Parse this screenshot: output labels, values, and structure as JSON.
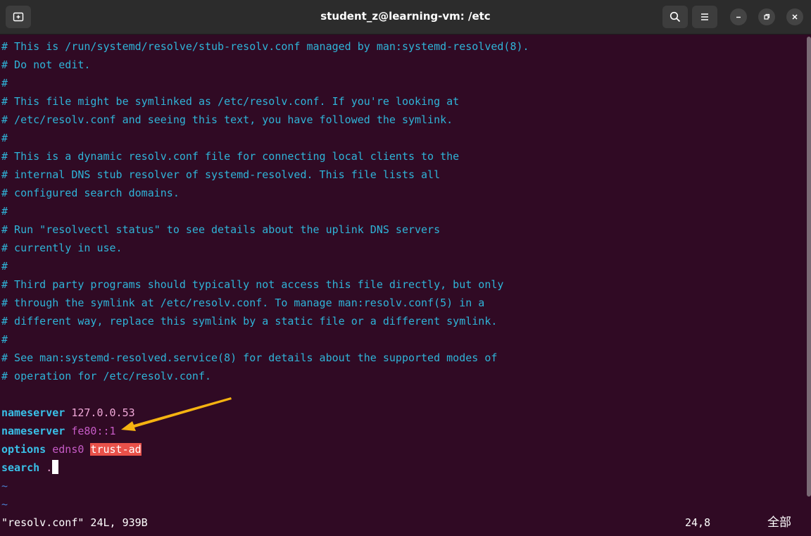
{
  "window": {
    "title": "student_z@learning-vm: /etc"
  },
  "icons": {
    "new_tab": "new-tab-icon",
    "search": "search-icon",
    "menu": "hamburger-menu-icon",
    "minimize": "minimize-icon",
    "maximize": "restore-icon",
    "close": "close-icon"
  },
  "editor": {
    "comment_lines": [
      "# This is /run/systemd/resolve/stub-resolv.conf managed by man:systemd-resolved(8).",
      "# Do not edit.",
      "#",
      "# This file might be symlinked as /etc/resolv.conf. If you're looking at",
      "# /etc/resolv.conf and seeing this text, you have followed the symlink.",
      "#",
      "# This is a dynamic resolv.conf file for connecting local clients to the",
      "# internal DNS stub resolver of systemd-resolved. This file lists all",
      "# configured search domains.",
      "#",
      "# Run \"resolvectl status\" to see details about the uplink DNS servers",
      "# currently in use.",
      "#",
      "# Third party programs should typically not access this file directly, but only",
      "# through the symlink at /etc/resolv.conf. To manage man:resolv.conf(5) in a",
      "# different way, replace this symlink by a static file or a different symlink.",
      "#",
      "# See man:systemd-resolved.service(8) for details about the supported modes of",
      "# operation for /etc/resolv.conf."
    ],
    "ns1_keyword": "nameserver",
    "ns1_value": "127.0.0.53",
    "ns2_keyword": "nameserver",
    "ns2_value": "fe80::1",
    "options_keyword": "options",
    "options_value1": "edns0",
    "options_value2": "trust-ad",
    "search_keyword": "search",
    "search_value": ".",
    "tilde": "~"
  },
  "status": {
    "file_info": "\"resolv.conf\" 24L, 939B",
    "cursor_pos": "24,8",
    "view_pos": "全部"
  },
  "colors": {
    "background": "#300a24",
    "comment": "#2fb4d8",
    "highlight": "#e9514a",
    "arrow": "#f5b311"
  }
}
